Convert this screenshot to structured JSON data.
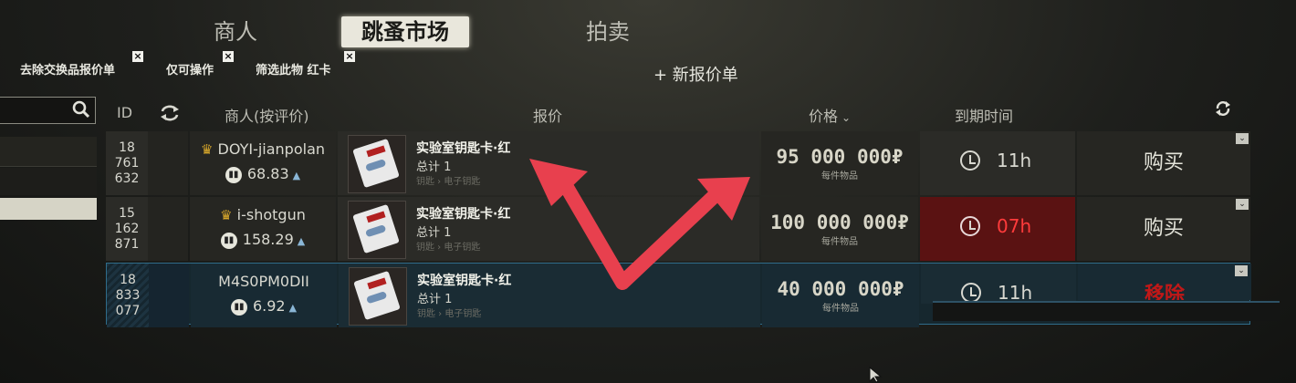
{
  "tabs": [
    {
      "label": "商人",
      "active": false
    },
    {
      "label": "跳蚤市场",
      "active": true
    },
    {
      "label": "拍卖",
      "active": false
    }
  ],
  "filters": [
    {
      "label": "去除交换品报价单"
    },
    {
      "label": "仅可操作"
    },
    {
      "label": "筛选此物 红卡"
    }
  ],
  "new_offer_label": "+ 新报价单",
  "columns": {
    "id": "ID",
    "trader": "商人(按评价)",
    "offer": "报价",
    "price": "价格",
    "expiry": "到期时间"
  },
  "icons": {
    "search": "search-icon",
    "sync": "swap-arrows-icon",
    "refresh": "refresh-icon",
    "clock": "clock-icon",
    "crown": "crown-icon",
    "rating": "rating-badge-icon",
    "dropdown": "chevron-down-icon"
  },
  "colors": {
    "accent_red": "#e8404e",
    "selected_row_border": "#2f6c8a",
    "warning_cell": "#5a1212"
  },
  "offers": [
    {
      "id_parts": [
        "18",
        "761",
        "632"
      ],
      "trader_name": "DOYI-jianpolan",
      "crown": true,
      "rating": "68.83",
      "item_name": "实验室钥匙卡·红",
      "item_total": "总计 1",
      "item_path": "钥匙 › 电子钥匙",
      "price": "95 000 000₽",
      "price_unit": "每件物品",
      "expiry": "11h",
      "action": "购买"
    },
    {
      "id_parts": [
        "15",
        "162",
        "871"
      ],
      "trader_name": "i-shotgun",
      "crown": true,
      "rating": "158.29",
      "item_name": "实验室钥匙卡·红",
      "item_total": "总计 1",
      "item_path": "钥匙 › 电子钥匙",
      "price": "100 000 000₽",
      "price_unit": "每件物品",
      "expiry": "07h",
      "action": "购买"
    },
    {
      "id_parts": [
        "18",
        "833",
        "077"
      ],
      "trader_name": "M4S0PM0DII",
      "crown": false,
      "rating": "6.92",
      "item_name": "实验室钥匙卡·红",
      "item_total": "总计 1",
      "item_path": "钥匙 › 电子钥匙",
      "price": "40 000 000₽",
      "price_unit": "每件物品",
      "expiry": "11h",
      "action": "移除"
    }
  ]
}
